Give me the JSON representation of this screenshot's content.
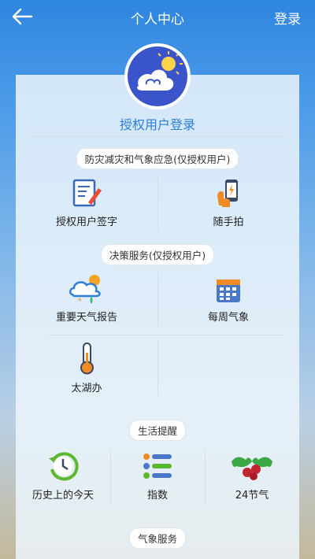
{
  "header": {
    "title": "个人中心",
    "login_label": "登录"
  },
  "profile": {
    "auth_login_label": "授权用户登录"
  },
  "sections": {
    "disaster": {
      "title": "防灾减灾和气象应急(仅授权用户)",
      "items": [
        {
          "label": "授权用户签字",
          "icon": "signature-icon"
        },
        {
          "label": "随手拍",
          "icon": "phone-camera-icon"
        }
      ]
    },
    "decision": {
      "title": "决策服务(仅授权用户)",
      "items": [
        {
          "label": "重要天气报告",
          "icon": "weather-report-icon"
        },
        {
          "label": "每周气象",
          "icon": "calendar-icon"
        },
        {
          "label": "太湖办",
          "icon": "thermometer-icon"
        }
      ]
    },
    "life": {
      "title": "生活提醒",
      "items": [
        {
          "label": "历史上的今天",
          "icon": "history-clock-icon"
        },
        {
          "label": "指数",
          "icon": "index-list-icon"
        },
        {
          "label": "24节气",
          "icon": "holly-icon"
        }
      ]
    },
    "weather": {
      "title": "气象服务"
    }
  },
  "colors": {
    "accent": "#2a7fd6",
    "header_bg": "#2f86e0"
  }
}
